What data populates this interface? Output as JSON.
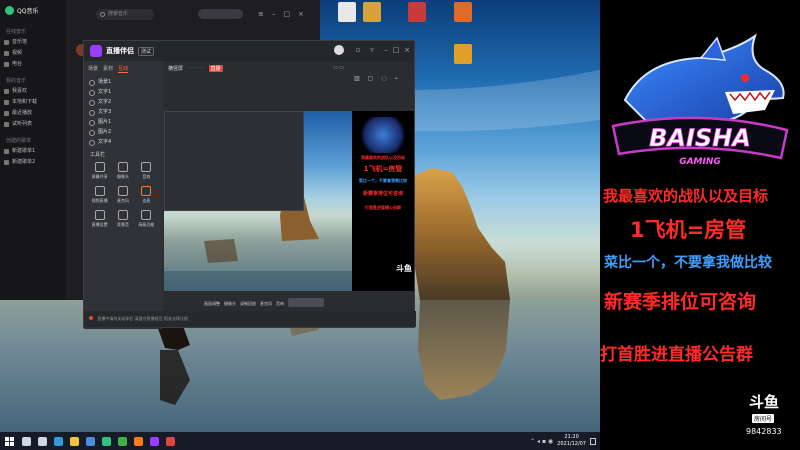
{
  "qq_music": {
    "title": "QQ音乐",
    "search_placeholder": "搜索音乐",
    "sidebar_sections": [
      "在线音乐",
      "我的音乐",
      "创建的歌单"
    ],
    "sidebar_items": [
      "音乐馆",
      "视频",
      "电台",
      "我喜欢",
      "本地和下载",
      "最近播放",
      "试听列表",
      "新建歌单1",
      "新建歌单2"
    ]
  },
  "live_companion": {
    "title": "直播伴侣",
    "version_badge": "测试",
    "tabs": [
      "场景",
      "素材",
      "互动"
    ],
    "scenes": [
      "场景1",
      "文字1",
      "文字2",
      "文字3",
      "图片1",
      "图片2",
      "文字4"
    ],
    "tools_title": "工具栏",
    "tools": [
      "屏幕共享",
      "摄像头",
      "音效",
      "视频直播",
      "麦克风",
      "连麦",
      "直播设置",
      "背景音",
      "高级功能"
    ],
    "toolbar_label": "横竖屏",
    "rec_badge": "直播",
    "bottom_buttons": [
      "画面调整",
      "摄像头",
      "录制回放",
      "麦克风",
      "音响"
    ],
    "footer_text": "直播中请勿关闭伴侣 请遵守直播规范 相关法律法规"
  },
  "overlay": {
    "line1": "我最喜欢的战队以及目标",
    "line2": "1飞机=房管",
    "line3": "菜比一个，不要拿我做比较",
    "line4": "新赛季排位可咨询",
    "line5": "打首胜进直播公告群",
    "team_logo_text": "BAISHA",
    "team_logo_sub": "GAMING",
    "douyu_logo": "斗鱼",
    "douyu_sub": "房间号",
    "room_id": "9842833"
  },
  "taskbar": {
    "time": "21:20",
    "date": "2021/12/07",
    "apps": [
      {
        "icon": "search-icon",
        "color": "#cfd8e6"
      },
      {
        "icon": "task-view-icon",
        "color": "#cfd8e6"
      },
      {
        "icon": "edge-icon",
        "color": "#2f9bd7"
      },
      {
        "icon": "folder-icon",
        "color": "#f3c242"
      },
      {
        "icon": "store-icon",
        "color": "#4c8be0"
      },
      {
        "icon": "qq-music-icon",
        "color": "#31c27c"
      },
      {
        "icon": "xbox-icon",
        "color": "#3fb24a"
      },
      {
        "icon": "douyu-icon",
        "color": "#ff7a1a"
      },
      {
        "icon": "live-companion-icon",
        "color": "#9a3cff"
      },
      {
        "icon": "app-icon",
        "color": "#e04545"
      }
    ]
  },
  "desktop_icons": [
    {
      "label": "",
      "color": "#e8e8e8"
    },
    {
      "label": "",
      "color": "#d8a23a"
    },
    {
      "label": "",
      "color": "#c93a3a"
    },
    {
      "label": "",
      "color": "#e06a2a"
    },
    {
      "label": "",
      "color": "#e0a02a"
    }
  ]
}
